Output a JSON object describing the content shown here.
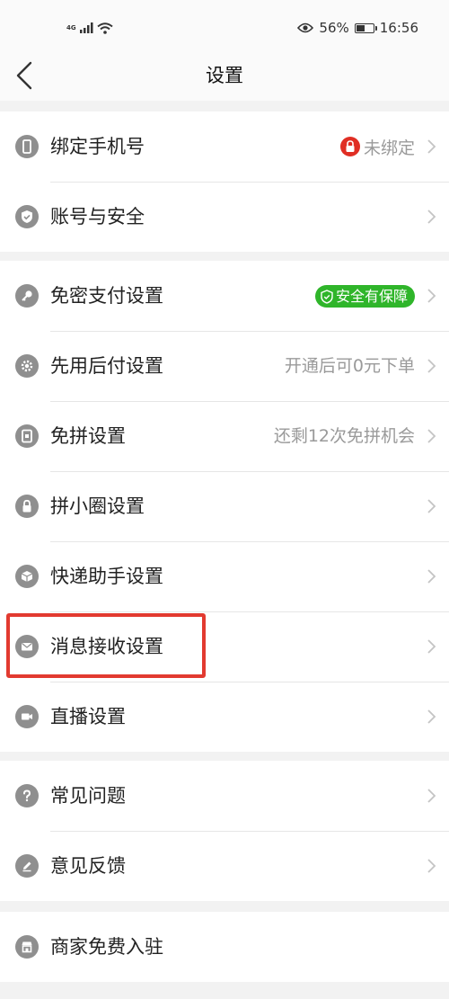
{
  "status_bar": {
    "network": "4G",
    "battery_percent": "56%",
    "battery_level": 0.56,
    "time": "16:56",
    "icons": [
      "signal-icon",
      "wifi-icon",
      "eye-icon",
      "battery-icon"
    ]
  },
  "nav": {
    "back_icon": "chevron-left-icon",
    "title": "设置"
  },
  "groups": {
    "account": {
      "phone": {
        "label": "绑定手机号",
        "value": "未绑定",
        "icon": "phone-icon",
        "status_icon": "red-lock-icon"
      },
      "security": {
        "label": "账号与安全",
        "icon": "shield-check-icon"
      }
    },
    "settings": {
      "password_free": {
        "label": "免密支付设置",
        "badge": "安全有保障",
        "icon": "key-icon"
      },
      "pay_later": {
        "label": "先用后付设置",
        "value": "开通后可0元下单",
        "icon": "gear-icon"
      },
      "free_group": {
        "label": "免拼设置",
        "value": "还剩12次免拼机会",
        "icon": "document-icon"
      },
      "circle": {
        "label": "拼小圈设置",
        "icon": "lock-icon"
      },
      "express": {
        "label": "快递助手设置",
        "icon": "package-icon"
      },
      "message": {
        "label": "消息接收设置",
        "icon": "mail-icon"
      },
      "live": {
        "label": "直播设置",
        "icon": "video-icon"
      }
    },
    "help": {
      "faq": {
        "label": "常见问题",
        "icon": "question-icon"
      },
      "feedback": {
        "label": "意见反馈",
        "icon": "pencil-icon"
      }
    },
    "merchant": {
      "join": {
        "label": "商家免费入驻",
        "icon": "store-icon"
      }
    }
  },
  "colors": {
    "highlight": "#e23a30",
    "badge_green": "#2fb52a",
    "lock_red": "#e02e24",
    "icon_gray": "#8f8f8f"
  }
}
